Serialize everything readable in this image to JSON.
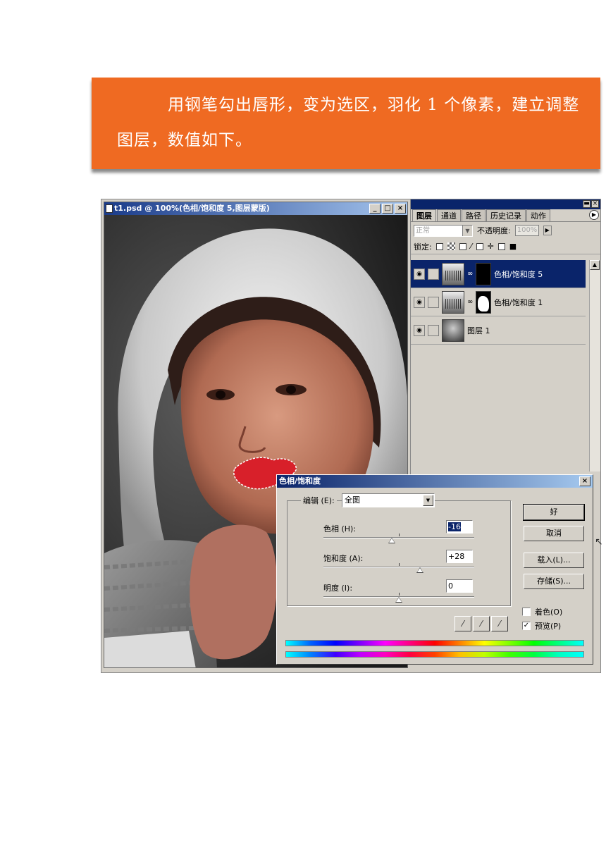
{
  "banner": {
    "text": "用钢笔勾出唇形，变为选区，羽化 1 个像素，建立调整图层，数值如下。"
  },
  "image_window": {
    "title": "t1.psd @ 100%(色相/饱和度 5,图层蒙版)",
    "minimize": "_",
    "maximize": "□",
    "close": "×"
  },
  "layers_panel": {
    "tabs": [
      "图层",
      "通道",
      "路径",
      "历史记录",
      "动作"
    ],
    "blend_mode": "正常",
    "opacity_label": "不透明度:",
    "opacity_value": "100%",
    "lock_label": "锁定:",
    "layers": [
      {
        "name": "色相/饱和度 5",
        "selected": true
      },
      {
        "name": "色相/饱和度 1",
        "selected": false
      },
      {
        "name": "图层 1",
        "selected": false
      }
    ]
  },
  "dialog": {
    "title": "色相/饱和度",
    "edit_label": "编辑 (E):",
    "edit_value": "全图",
    "sliders": [
      {
        "label": "色相 (H):",
        "value": "-16",
        "level": -16,
        "range": [
          -180,
          180
        ]
      },
      {
        "label": "饱和度 (A):",
        "value": "+28",
        "level": 28,
        "range": [
          -100,
          100
        ]
      },
      {
        "label": "明度 (I):",
        "value": "0",
        "level": 0,
        "range": [
          -100,
          100
        ]
      }
    ],
    "buttons": {
      "ok": "好",
      "cancel": "取消",
      "load": "载入(L)...",
      "save": "存储(S)..."
    },
    "colorize_label": "着色(O)",
    "colorize_checked": false,
    "preview_label": "预览(P)",
    "preview_checked": true,
    "check_mark": "✓",
    "eyedroppers": [
      "eyedropper-icon",
      "eyedropper-plus-icon",
      "eyedropper-minus-icon"
    ]
  }
}
